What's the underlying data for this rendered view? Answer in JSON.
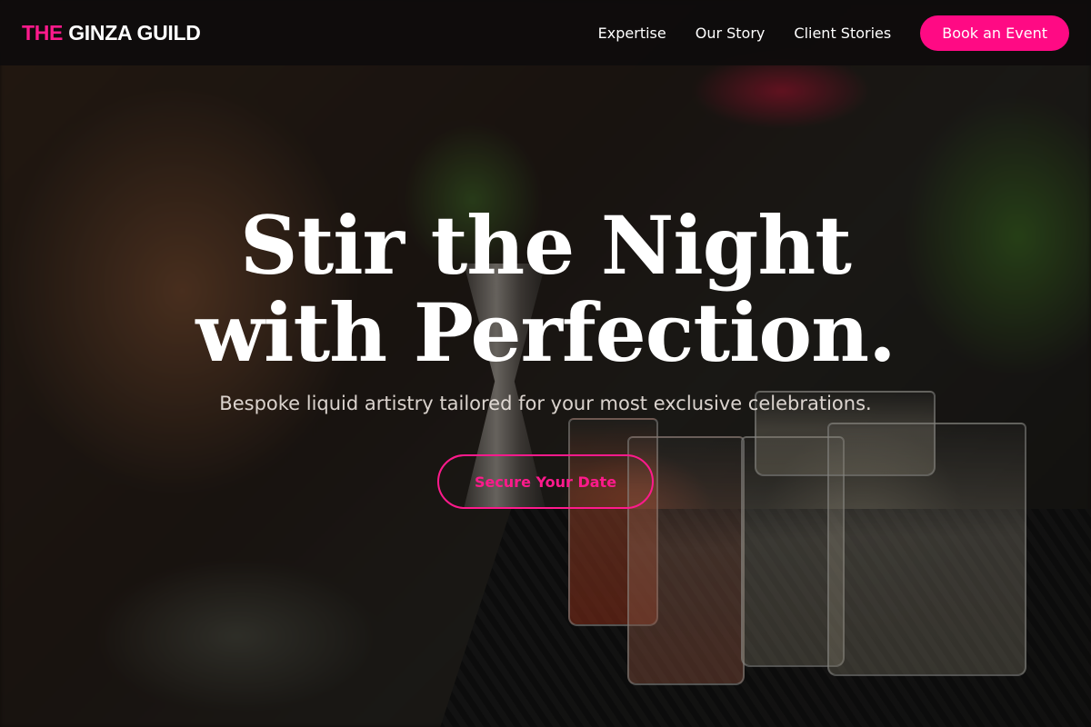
{
  "brand": {
    "logo_prefix": "THE",
    "logo_rest": "GINZA GUILD",
    "accent_color": "#ff1a8c"
  },
  "nav": {
    "links": [
      {
        "label": "Expertise"
      },
      {
        "label": "Our Story"
      },
      {
        "label": "Client Stories"
      }
    ],
    "cta_label": "Book an Event"
  },
  "hero": {
    "headline_line1": "Stir the Night",
    "headline_line2": "with Perfection.",
    "subheadline": "Bespoke liquid artistry tailored for your most exclusive celebrations.",
    "cta_label": "Secure Your Date"
  }
}
